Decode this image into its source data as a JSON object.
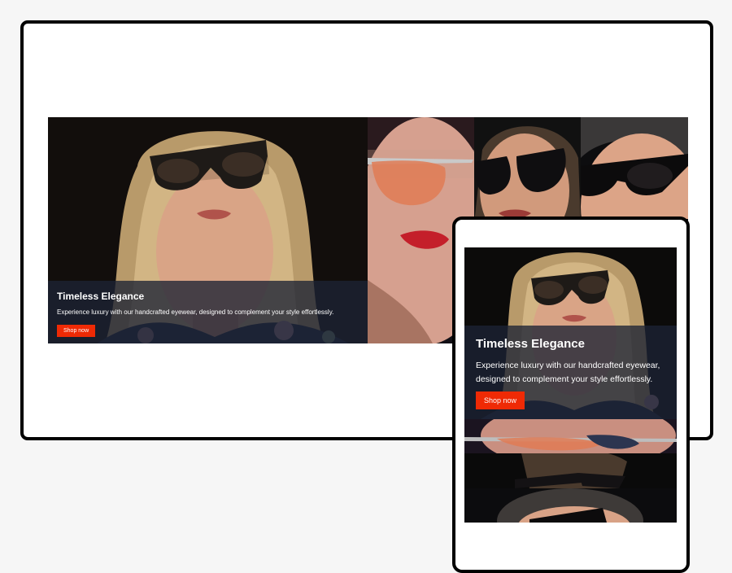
{
  "hero": {
    "title": "Timeless Elegance",
    "description": "Experience luxury with our handcrafted eyewear, designed to complement your style effortlessly.",
    "cta_label": "Shop now"
  },
  "colors": {
    "accent": "#ef2a05",
    "caption_overlay": "#1c2234",
    "frame": "#000000",
    "page_background": "#f6f6f6"
  },
  "images": {
    "main": "woman-tortoise-sunglasses-photo",
    "second": "woman-aviator-sunglasses-photo",
    "third": "woman-cateye-sunglasses-photo",
    "fourth": "woman-black-sunglasses-photo"
  }
}
